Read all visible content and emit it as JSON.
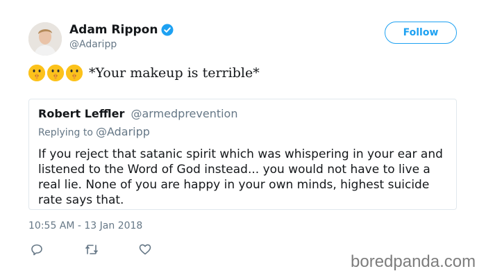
{
  "tweet": {
    "author_name": "Adam Rippon",
    "author_handle": "@Adaripp",
    "follow_label": "Follow",
    "emojis": [
      "shushing-face-emoji",
      "shushing-face-emoji",
      "shushing-face-emoji"
    ],
    "text": "*Your makeup is terrible*",
    "timestamp": "10:55 AM - 13 Jan 2018",
    "actions": [
      "reply-icon",
      "retweet-icon",
      "like-icon"
    ]
  },
  "quoted": {
    "author_name": "Robert Leffler",
    "author_handle": "@armedprevention",
    "replying_prefix": "Replying to",
    "replying_to": "@Adaripp",
    "text": "If you reject that satanic spirit which was whispering in your ear and listened to the Word of God instead... you would not have to live a real lie.  None of you are happy in your own minds, highest suicide rate says that."
  },
  "watermark": "boredpanda.com",
  "colors": {
    "accent": "#1da1f2",
    "text": "#14171a",
    "muted": "#657786",
    "border": "#e1e8ed",
    "emoji": "#fcc21b"
  }
}
